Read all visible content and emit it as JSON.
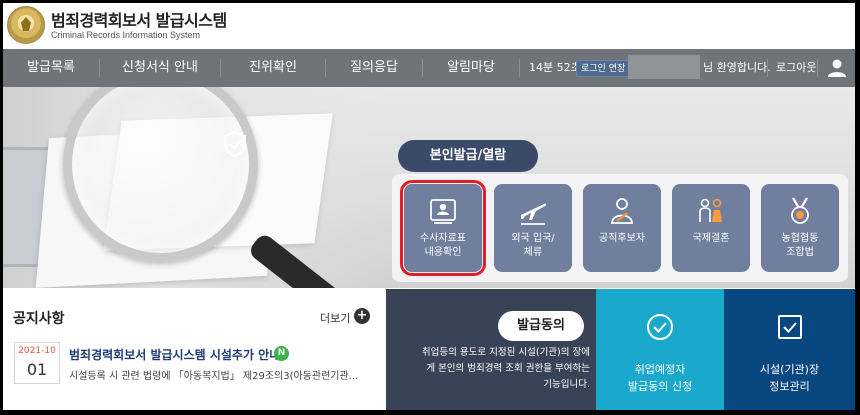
{
  "header": {
    "title": "범죄경력회보서 발급시스템",
    "subtitle": "Criminal Records Information System",
    "logo_icon": "police-emblem-icon"
  },
  "nav": {
    "items": [
      {
        "label": "발급목록"
      },
      {
        "label": "신청서식 안내"
      },
      {
        "label": "진위확인"
      },
      {
        "label": "질의응답"
      },
      {
        "label": "알림마당"
      }
    ],
    "session_timer": "14분 52초",
    "extend_label": "로그인 연장",
    "welcome": "님 환영합니다.",
    "logout": "로그아웃",
    "user_icon": "user-icon"
  },
  "panel": {
    "tab_label": "본인발급/열람",
    "services": [
      {
        "label1": "수사자료표",
        "label2": "내용확인",
        "icon": "id-card-icon",
        "selected": true
      },
      {
        "label1": "외국 입국/",
        "label2": "체류",
        "icon": "airplane-icon",
        "selected": false
      },
      {
        "label1": "공직후보자",
        "label2": "",
        "icon": "candidate-icon",
        "selected": false
      },
      {
        "label1": "국제결혼",
        "label2": "",
        "icon": "couple-icon",
        "selected": false
      },
      {
        "label1": "농협협동",
        "label2": "조합법",
        "icon": "medal-icon",
        "selected": false
      }
    ]
  },
  "notice": {
    "title": "공지사항",
    "more": "더보기",
    "item": {
      "date_ym": "2021-10",
      "date_d": "01",
      "title": "범죄경력회보서 발급시스템 시설추가 안내",
      "badge": "N",
      "body": "시설등록 시 관련 법령에 「아동복지법」 제29조의3(아동관련기관..."
    }
  },
  "consent": {
    "button": "발급동의",
    "text1": "취업등의 용도로 지정된 시설(기관)의 장에",
    "text2": "게 본인의 범죄경력 조회 권한을 부여하는",
    "text3": "기능입니다.",
    "tile1_l1": "취업예정자",
    "tile1_l2": "발급동의 신청",
    "tile2_l1": "시설(기관)장",
    "tile2_l2": "정보관리"
  },
  "colors": {
    "nav": "#707378",
    "panel_tab": "#3c4a6a",
    "service": "#717f9e",
    "highlight": "#e31e24",
    "consent": "#394357",
    "tile1": "#1aa9cc",
    "tile2": "#094781"
  }
}
